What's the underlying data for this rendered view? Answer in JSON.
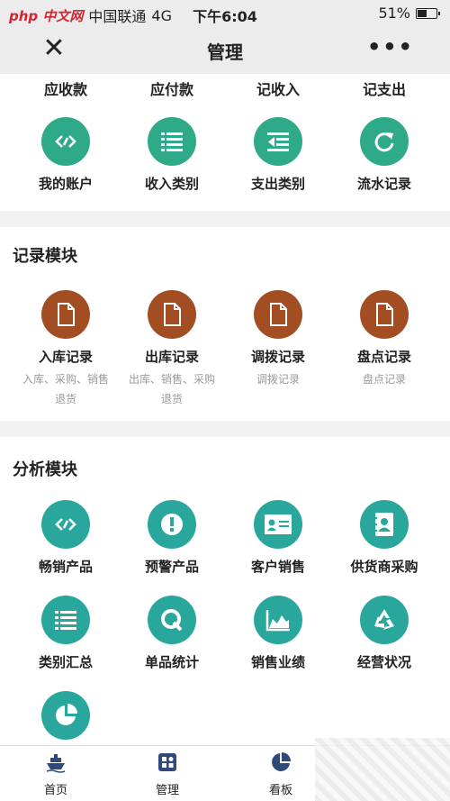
{
  "statusbar": {
    "logo": "php 中文网",
    "carrier": "中国联通",
    "network": "4G",
    "time": "下午6:04",
    "battery": "51%",
    "battery_level": 0.51
  },
  "navbar": {
    "close_glyph": "✕",
    "title": "管理",
    "more_glyph": "•••"
  },
  "finance": {
    "top_items": [
      "应收款",
      "应付款",
      "记收入",
      "记支出"
    ],
    "items": [
      {
        "label": "我的账户",
        "icon": "diamond-link-icon"
      },
      {
        "label": "收入类别",
        "icon": "list-icon"
      },
      {
        "label": "支出类别",
        "icon": "list-out-icon"
      },
      {
        "label": "流水记录",
        "icon": "refresh-icon"
      }
    ]
  },
  "records": {
    "title": "记录模块",
    "items": [
      {
        "label": "入库记录",
        "sub1": "入库、采购、销售",
        "sub2": "退货",
        "icon": "document-icon"
      },
      {
        "label": "出库记录",
        "sub1": "出库、销售、采购",
        "sub2": "退货",
        "icon": "document-icon"
      },
      {
        "label": "调拨记录",
        "sub1": "调拨记录",
        "sub2": "",
        "icon": "document-icon"
      },
      {
        "label": "盘点记录",
        "sub1": "盘点记录",
        "sub2": "",
        "icon": "document-icon"
      }
    ]
  },
  "analysis": {
    "title": "分析模块",
    "items": [
      {
        "label": "畅销产品",
        "icon": "diamond-link-icon"
      },
      {
        "label": "预警产品",
        "icon": "alert-icon"
      },
      {
        "label": "客户销售",
        "icon": "id-card-icon"
      },
      {
        "label": "供货商采购",
        "icon": "contact-book-icon"
      },
      {
        "label": "类别汇总",
        "icon": "list-icon"
      },
      {
        "label": "单品统计",
        "icon": "q-icon"
      },
      {
        "label": "销售业绩",
        "icon": "area-chart-icon"
      },
      {
        "label": "经营状况",
        "icon": "recycle-icon"
      },
      {
        "label": "",
        "icon": "pie-chart-icon"
      }
    ]
  },
  "tabbar": {
    "home": "首页",
    "manage": "管理",
    "board": "看板"
  },
  "colors": {
    "teal": "#2aa79c",
    "brown": "#a34e22",
    "tab_icon": "#2f4a7a"
  }
}
